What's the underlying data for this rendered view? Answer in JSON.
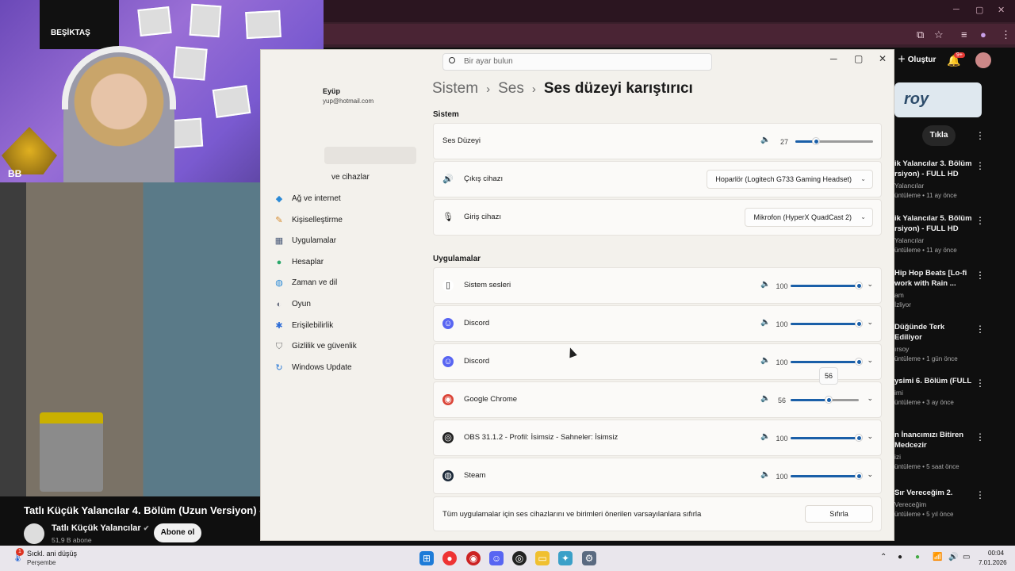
{
  "browser": {
    "create_label": "Oluştur",
    "notification_badge": "9+"
  },
  "webcam": {
    "banner_text": "BEŞİKTAŞ",
    "corner_text": "BB"
  },
  "video": {
    "title": "Tatlı Küçük Yalancılar 4. Bölüm (Uzun Versiyon) -",
    "channel_name": "Tatlı Küçük Yalancılar",
    "subscribers": "51,9 B abone",
    "subscribe_label": "Abone ol"
  },
  "sidebar_right": {
    "banner_text": "roy",
    "click_label": "Tıkla",
    "items": [
      {
        "title": "ik Yalancılar 3. Bölüm\nrsiyon) - FULL HD",
        "channel": "Yalancılar",
        "meta": "üntüleme • 11 ay önce"
      },
      {
        "title": "ik Yalancılar 5. Bölüm\nrsiyon) - FULL HD",
        "channel": "Yalancılar",
        "meta": "üntüleme • 11 ay önce"
      },
      {
        "title": "Hip Hop Beats [Lo-fi\nwork with Rain ...",
        "channel": "am",
        "meta": "İzliyor"
      },
      {
        "title": "Düğünde Terk Ediliyor",
        "channel": "ırsoy",
        "meta": "üntüleme • 1 gün önce"
      },
      {
        "title": "ysimi 6. Bölüm (FULL",
        "channel": "imi",
        "meta": "üntüleme • 3 ay önce"
      },
      {
        "title": "n İnancımızı Bitiren\nMedcezir",
        "channel": "izi",
        "meta": "üntüleme • 5 saat önce"
      },
      {
        "title": "Sır Vereceğim 2.",
        "channel": "Vereceğim",
        "meta": "üntüleme • 5 yıl önce"
      }
    ]
  },
  "settings": {
    "search_placeholder": "Bir ayar bulun",
    "account": {
      "name": "Eyüp",
      "email": "yup@hotmail.com"
    },
    "breadcrumb": {
      "root": "Sistem",
      "mid": "Ses",
      "current": "Ses düzeyi karıştırıcı"
    },
    "nav": [
      {
        "label": "ve cihazlar",
        "icon": "bluetooth-devices-icon"
      },
      {
        "label": "Ağ ve internet",
        "icon": "wifi-icon"
      },
      {
        "label": "Kişiselleştirme",
        "icon": "brush-icon"
      },
      {
        "label": "Uygulamalar",
        "icon": "apps-icon"
      },
      {
        "label": "Hesaplar",
        "icon": "person-icon"
      },
      {
        "label": "Zaman ve dil",
        "icon": "globe-icon"
      },
      {
        "label": "Oyun",
        "icon": "gamepad-icon"
      },
      {
        "label": "Erişilebilirlik",
        "icon": "accessibility-icon"
      },
      {
        "label": "Gizlilik ve güvenlik",
        "icon": "shield-icon"
      },
      {
        "label": "Windows Update",
        "icon": "update-icon"
      }
    ],
    "system_section_label": "Sistem",
    "system_volume": {
      "label": "Ses Düzeyi",
      "value": "27",
      "level": 0.27
    },
    "output": {
      "label": "Çıkış cihazı",
      "value": "Hoparlör (Logitech G733 Gaming Headset)"
    },
    "input": {
      "label": "Giriş cihazı",
      "value": "Mikrofon (HyperX QuadCast 2)"
    },
    "apps_section_label": "Uygulamalar",
    "apps": [
      {
        "name": "Sistem sesleri",
        "value": "100",
        "level": 1.0,
        "icon": "speaker-icon"
      },
      {
        "name": "Discord",
        "value": "100",
        "level": 1.0,
        "icon": "discord-icon"
      },
      {
        "name": "Discord",
        "value": "100",
        "level": 1.0,
        "icon": "discord-icon"
      },
      {
        "name": "Google Chrome",
        "value": "56",
        "level": 0.56,
        "icon": "chrome-icon"
      },
      {
        "name": "OBS 31.1.2 - Profil: İsimsiz - Sahneler: İsimsiz",
        "value": "100",
        "level": 1.0,
        "icon": "obs-icon"
      },
      {
        "name": "Steam",
        "value": "100",
        "level": 1.0,
        "icon": "steam-icon"
      }
    ],
    "tooltip_value": "56",
    "reset_text": "Tüm uygulamalar için ses cihazlarını ve birimleri önerilen varsayılanlara sıfırla",
    "reset_label": "Sıfırla"
  },
  "taskbar": {
    "weather_title": "Sıckl. ani düşüş",
    "weather_sub": "Perşembe",
    "weather_badge": "1",
    "time": "00:04",
    "date": "7.01.2026"
  },
  "colors": {
    "accent": "#1a5fa8",
    "settings_bg": "#f3f1ec",
    "yt_bg": "#0f0f0f"
  }
}
